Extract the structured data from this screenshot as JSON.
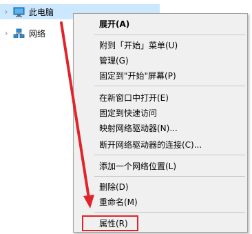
{
  "nav_tree": [
    {
      "label": "此电脑",
      "icon": "computer-icon",
      "selected": true
    },
    {
      "label": "网络",
      "icon": "network-icon",
      "selected": false
    }
  ],
  "context_menu": {
    "items": [
      {
        "label": "展开(A)",
        "bold": true
      },
      {
        "label": "附到「开始」菜单(U)"
      },
      {
        "label": "管理(G)"
      },
      {
        "label": "固定到\"开始\"屏幕(P)"
      },
      {
        "label": "在新窗口中打开(E)"
      },
      {
        "label": "固定到快速访问"
      },
      {
        "label": "映射网络驱动器(N)..."
      },
      {
        "label": "断开网络驱动器的连接(C)..."
      },
      {
        "label": "添加一个网络位置(L)"
      },
      {
        "label": "删除(D)"
      },
      {
        "label": "重命名(M)"
      },
      {
        "label": "属性(R)",
        "highlighted": true
      }
    ]
  },
  "annotation": {
    "color": "#e0242a"
  },
  "colors": {
    "selection": "#cce8ff",
    "menu_bg": "#f0f0f0"
  }
}
